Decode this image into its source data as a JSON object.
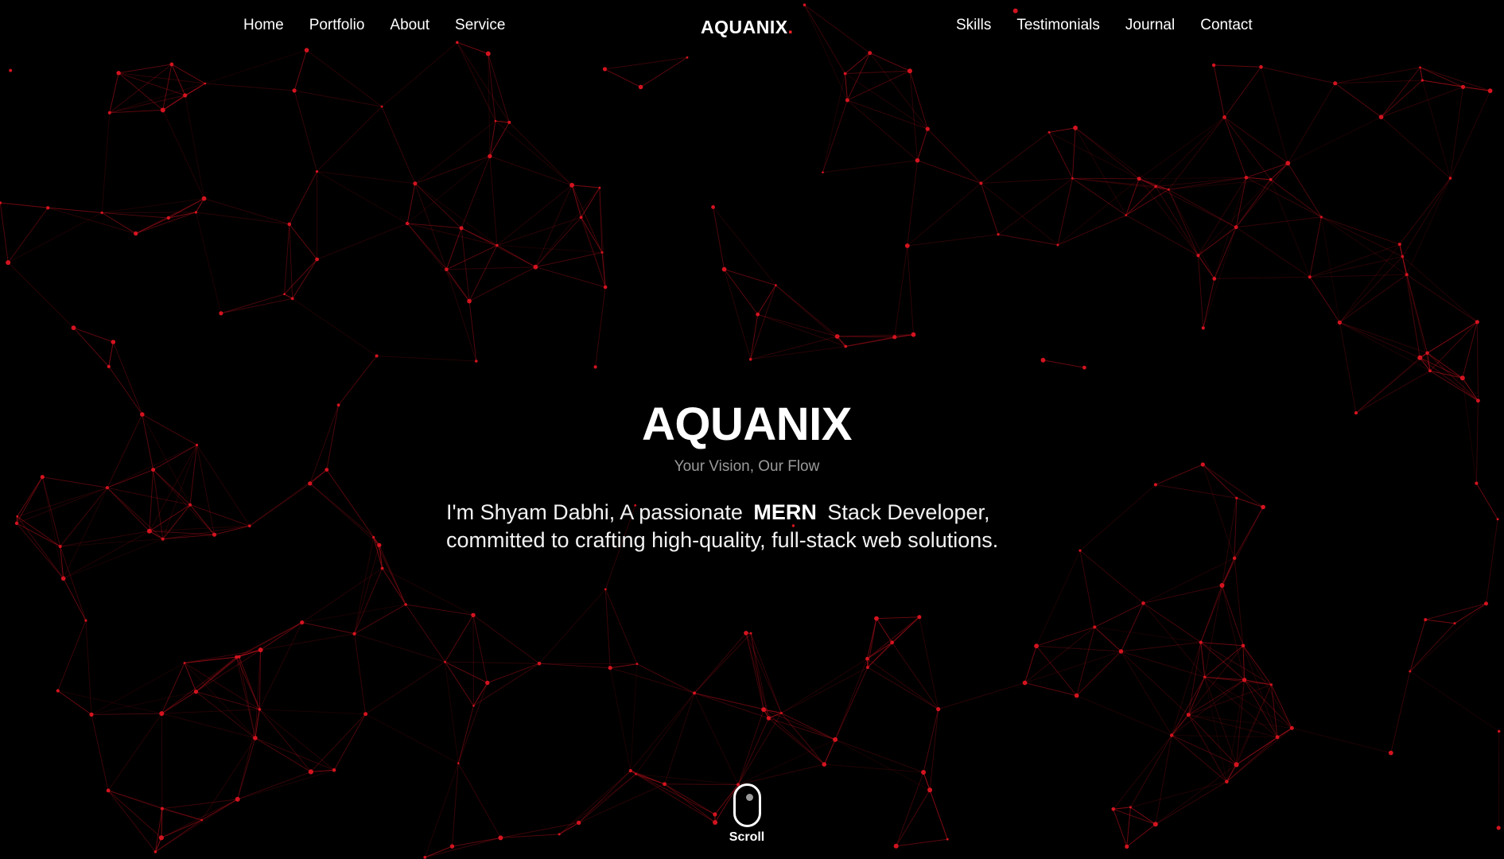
{
  "nav": {
    "left_links": [
      "Home",
      "Portfolio",
      "About",
      "Service"
    ],
    "right_links": [
      "Skills",
      "Testimonials",
      "Journal",
      "Contact"
    ],
    "brand": "AQUANIX",
    "brand_dot": "."
  },
  "hero": {
    "title": "AQUANIX",
    "subtitle": "Your Vision, Our Flow",
    "intro_prefix": "I'm Shyam Dabhi, A passionate",
    "intro_highlight": "MERN",
    "intro_suffix": "Stack Developer, committed to crafting high-quality, full-stack web solutions."
  },
  "scroll": {
    "label": "Scroll"
  },
  "colors": {
    "background": "#000000",
    "accent": "#ff2525",
    "network_line": "#b3101a",
    "network_node": "#d3141f",
    "subtitle_text": "#9a9a9a"
  },
  "icons": {
    "scroll": "mouse-icon"
  }
}
